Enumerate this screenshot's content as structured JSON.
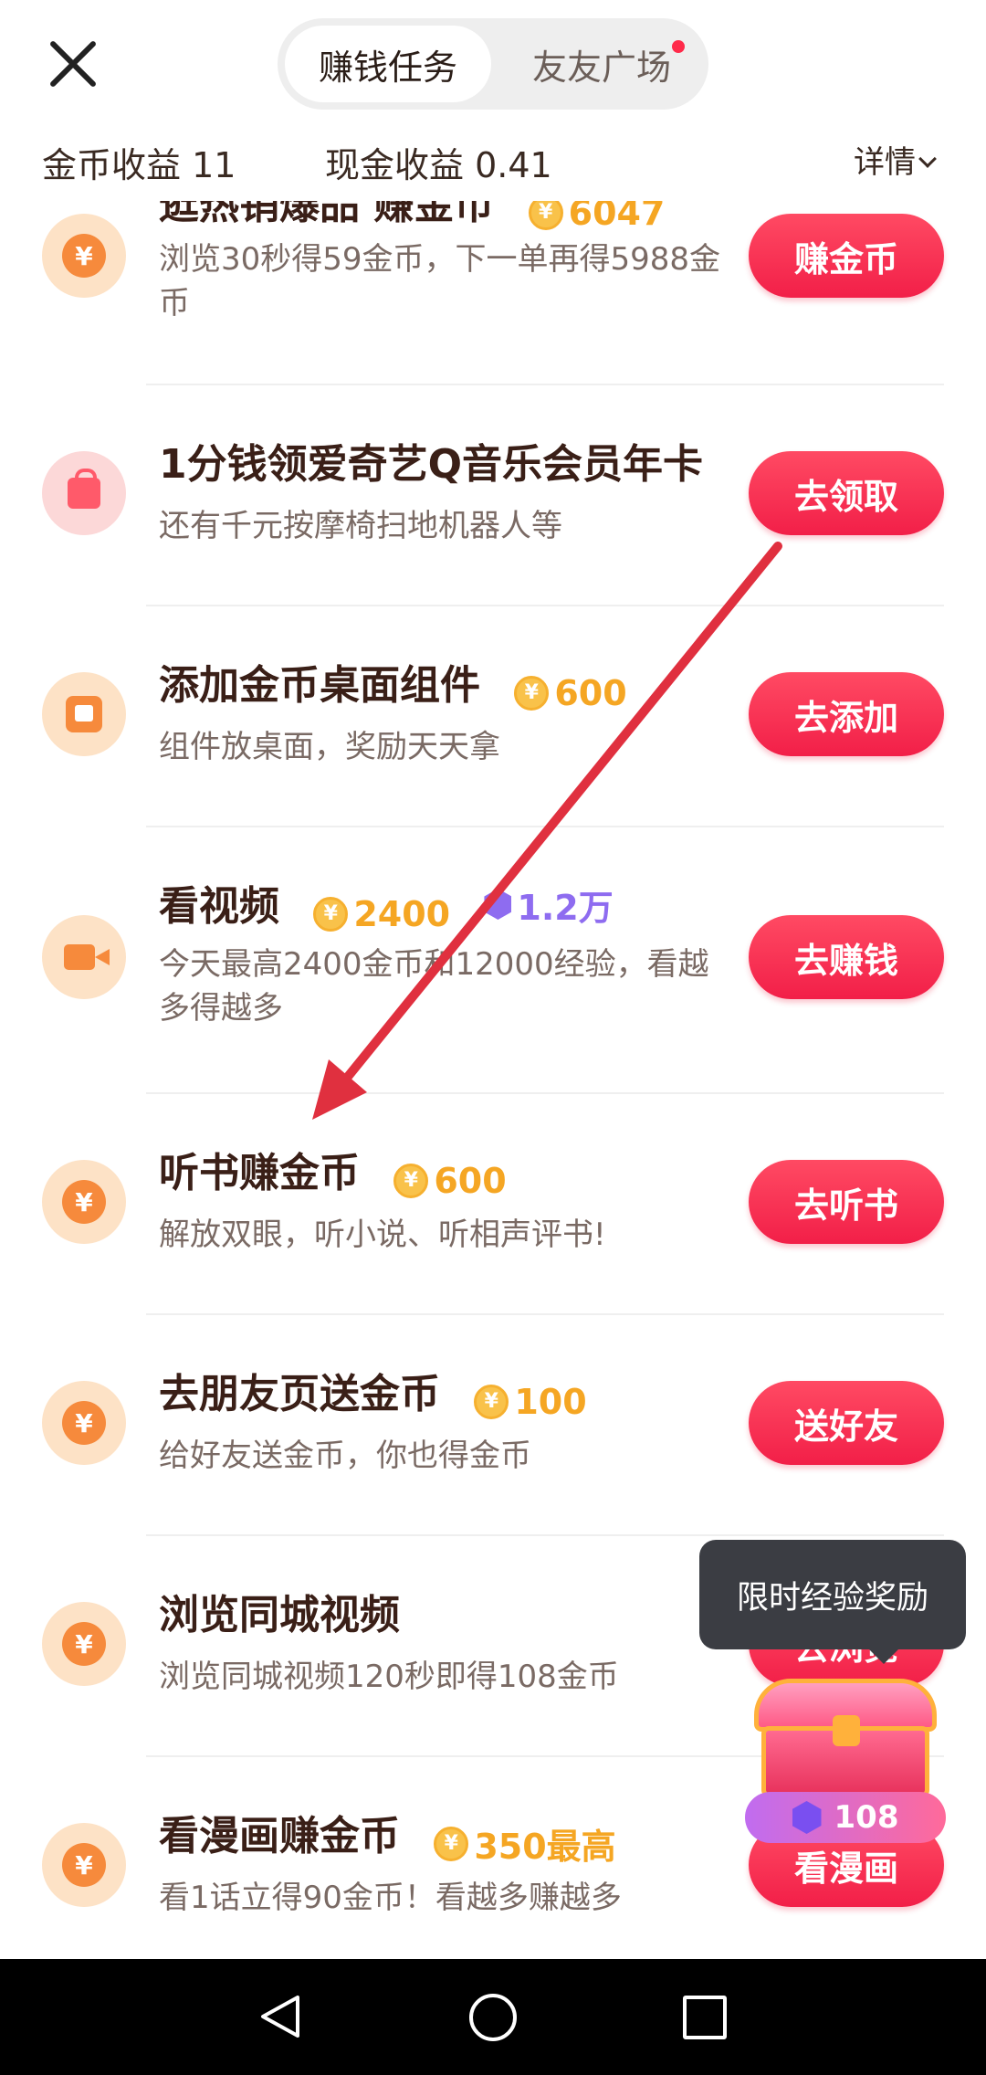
{
  "header": {
    "tab_active": "赚钱任务",
    "tab_inactive": "友友广场",
    "stat_gold": "金币收益 11",
    "stat_cash": "现金收益 0.41",
    "detail_label": "详情"
  },
  "tasks": [
    {
      "title": "逛热销爆品 赚金币",
      "reward": "6047",
      "desc": "浏览30秒得59金币，下一单再得5988金币",
      "button": "赚金币"
    },
    {
      "title": "1分钱领爱奇艺Q音乐会员年卡",
      "desc": "还有千元按摩椅扫地机器人等",
      "button": "去领取"
    },
    {
      "title": "添加金币桌面组件",
      "reward": "600",
      "desc": "组件放桌面，奖励天天拿",
      "button": "去添加"
    },
    {
      "title": "看视频",
      "reward": "2400",
      "exp_reward": "1.2万",
      "desc": "今天最高2400金币和12000经验，看越多得越多",
      "button": "去赚钱"
    },
    {
      "title": "听书赚金币",
      "reward": "600",
      "desc": "解放双眼，听小说、听相声评书!",
      "button": "去听书"
    },
    {
      "title": "去朋友页送金币",
      "reward": "100",
      "desc": "给好友送金币，你也得金币",
      "button": "送好友"
    },
    {
      "title": "浏览同城视频",
      "desc": "浏览同城视频120秒即得108金币",
      "button": "去浏览"
    },
    {
      "title": "看漫画赚金币",
      "reward": "350最高",
      "desc": "看1话立得90金币！看越多赚越多",
      "button": "看漫画"
    }
  ],
  "coin_symbol": "¥",
  "popup": {
    "tooltip": "限时经验奖励",
    "exp_value": "108"
  },
  "colors": {
    "accent": "#f21f48",
    "coin_orange": "#f5a623",
    "exp_purple": "#8e6cf0",
    "annotation_arrow": "#e0303f"
  },
  "icons": [
    "close-icon",
    "coin-icon",
    "shopping-bag-icon",
    "widget-icon",
    "video-camera-icon",
    "chest-icon",
    "exp-gem-icon",
    "back-icon",
    "home-icon",
    "recents-icon"
  ]
}
